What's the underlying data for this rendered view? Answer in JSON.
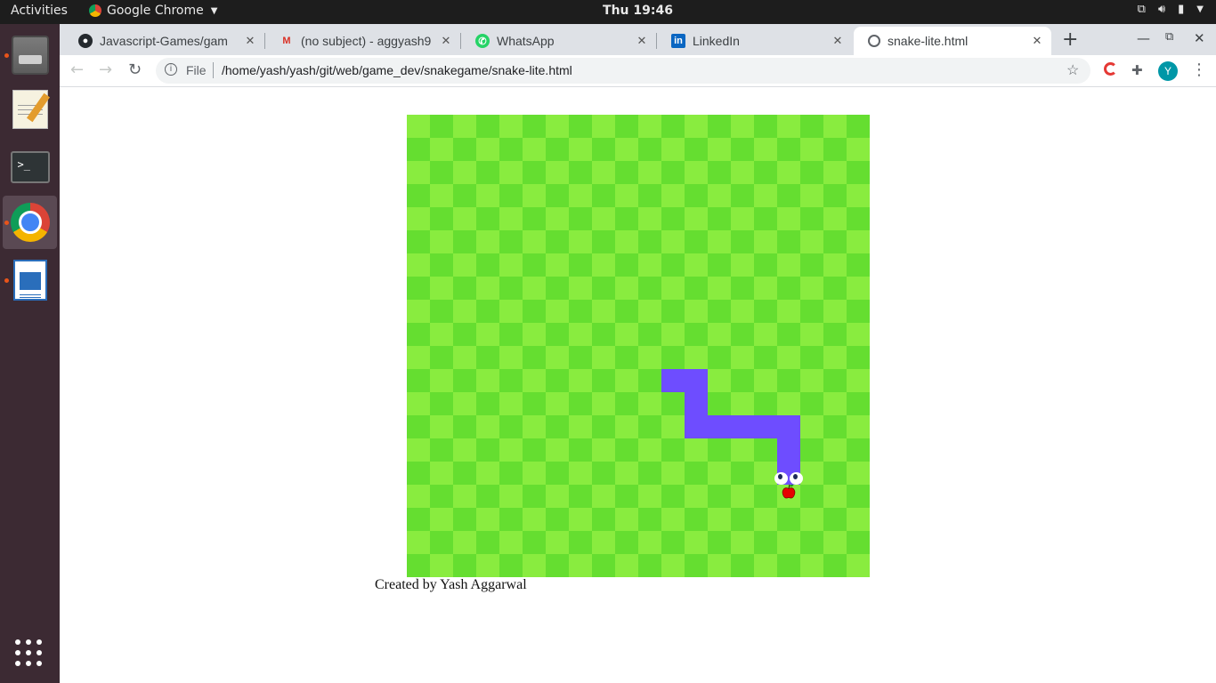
{
  "system": {
    "activities": "Activities",
    "app_name": "Google Chrome",
    "clock": "Thu 19:46"
  },
  "tabs": [
    {
      "title": "Javascript-Games/gam",
      "icon": "github-icon"
    },
    {
      "title": "(no subject) - aggyash9",
      "icon": "gmail-icon"
    },
    {
      "title": "WhatsApp",
      "icon": "whatsapp-icon"
    },
    {
      "title": "LinkedIn",
      "icon": "linkedin-icon"
    },
    {
      "title": "snake-lite.html",
      "icon": "globe-icon",
      "active": true
    }
  ],
  "toolbar": {
    "scheme": "File",
    "url": "/home/yash/yash/git/web/game_dev/snakegame/snake-lite.html",
    "profile_initial": "Y"
  },
  "game": {
    "board_colors": {
      "light": "#89ec3f",
      "dark": "#65de30"
    },
    "snake_color": "#6e4dff",
    "grid": {
      "cols": 20,
      "rows": 20
    },
    "snake_cells": [
      [
        11,
        11
      ],
      [
        12,
        11
      ],
      [
        12,
        12
      ],
      [
        12,
        13
      ],
      [
        13,
        13
      ],
      [
        14,
        13
      ],
      [
        15,
        13
      ],
      [
        16,
        13
      ],
      [
        16,
        14
      ],
      [
        16,
        15
      ]
    ],
    "food_cell": [
      16,
      16
    ],
    "credit": "Created by Yash Aggarwal"
  }
}
